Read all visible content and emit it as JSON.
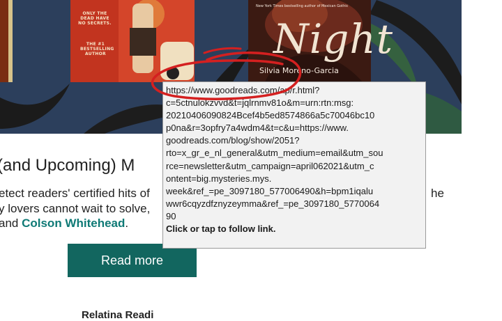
{
  "hero": {
    "book1": {
      "tagline": "ONLY THE DEAD HAVE NO SECRETS.",
      "badge": "THE #1 BESTSELLING AUTHOR"
    },
    "book2": {
      "title": "Night",
      "author": "Silvia Moreno-Garcia",
      "tagline": "New York Times bestselling author of Mexican Gothic"
    }
  },
  "article": {
    "heading": "(and Upcoming) M",
    "lines": [
      "etect readers' certified hits of",
      "y lovers cannot wait to solve,",
      " and "
    ],
    "link": "Colson Whitehead",
    "after_link": ".",
    "right_fragment": "he",
    "read_more": "Read more",
    "related": "Relatina Readi"
  },
  "tooltip": {
    "lines": [
      "https://www.goodreads.com/ap/r.html?",
      "c=5ctnulokzvvd&t=jqlrnmv81o&m=urn:rtn:msg:",
      "20210406090824Bcef4b5ed8574866a5c70046bc10",
      "p0na&r=3opfry7a4wdm4&t=c&u=https://www.",
      "goodreads.com/blog/show/2051?",
      "rto=x_gr_e_nl_general&utm_medium=email&utm_sou",
      "rce=newsletter&utm_campaign=april062021&utm_c",
      "ontent=big.mysteries.mys.",
      "week&ref_=pe_3097180_577006490&h=bpm1iqalu",
      "wwr6cqyzdfznyzeymma&ref_=pe_3097180_5770064",
      "90"
    ],
    "hint": "Click or tap to follow link."
  },
  "colors": {
    "hero_bg": "#2c3f5c",
    "accent_teal": "#12665f",
    "link_teal": "#0f7a76",
    "annotation_red": "#d42020"
  }
}
